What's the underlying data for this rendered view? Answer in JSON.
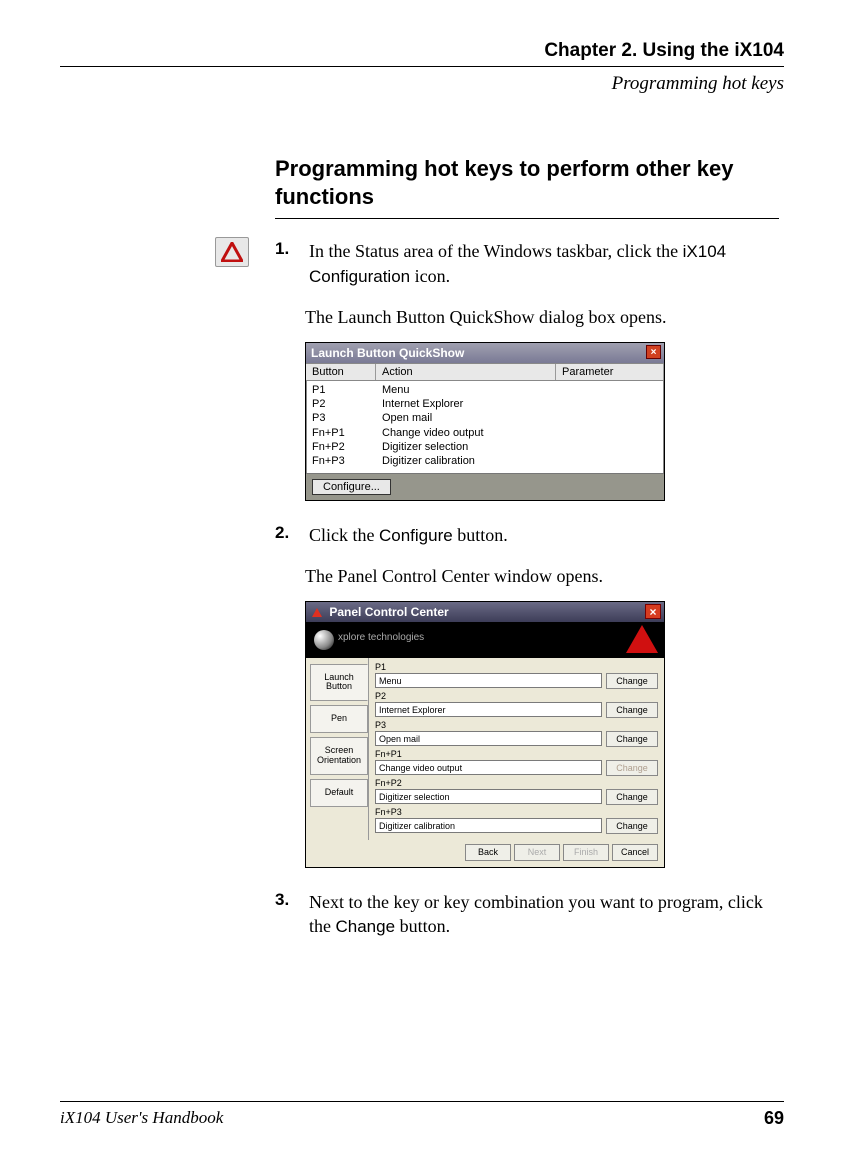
{
  "header": {
    "chapter": "Chapter 2. Using the iX104",
    "section": "Programming hot keys"
  },
  "heading": "Programming hot keys to perform other key functions",
  "steps": {
    "s1": {
      "num": "1.",
      "text_a": "In the Status area of the Windows taskbar, click the ",
      "ui_a": "iX104 Configuration",
      "text_b": " icon.",
      "follow": "The Launch Button QuickShow dialog box opens."
    },
    "s2": {
      "num": "2.",
      "text_a": "Click the ",
      "ui_a": "Configure",
      "text_b": " button.",
      "follow": "The Panel Control Center window opens."
    },
    "s3": {
      "num": "3.",
      "text_a": "Next to the key or key combination you want to program, click the ",
      "ui_a": "Change",
      "text_b": " button."
    }
  },
  "quickshow": {
    "title": "Launch Button QuickShow",
    "close_glyph": "×",
    "headers": {
      "button": "Button",
      "action": "Action",
      "parameter": "Parameter"
    },
    "rows": [
      {
        "b": "P1",
        "a": "Menu"
      },
      {
        "b": "P2",
        "a": "Internet Explorer"
      },
      {
        "b": "P3",
        "a": "Open mail"
      },
      {
        "b": "Fn+P1",
        "a": "Change video output"
      },
      {
        "b": "Fn+P2",
        "a": "Digitizer selection"
      },
      {
        "b": "Fn+P3",
        "a": "Digitizer calibration"
      }
    ],
    "configure": "Configure..."
  },
  "pcc": {
    "title": "Panel Control Center",
    "close_glyph": "×",
    "banner_text": "xplore technologies",
    "tabs": {
      "launch": "Launch\nButton",
      "pen": "Pen",
      "screen": "Screen\nOrientation",
      "default": "Default"
    },
    "rows": [
      {
        "label": "P1",
        "value": "Menu",
        "btn": "Change",
        "disabled": false
      },
      {
        "label": "P2",
        "value": "Internet Explorer",
        "btn": "Change",
        "disabled": false
      },
      {
        "label": "P3",
        "value": "Open mail",
        "btn": "Change",
        "disabled": false
      },
      {
        "label": "Fn+P1",
        "value": "Change video output",
        "btn": "Change",
        "disabled": true
      },
      {
        "label": "Fn+P2",
        "value": "Digitizer selection",
        "btn": "Change",
        "disabled": false
      },
      {
        "label": "Fn+P3",
        "value": "Digitizer calibration",
        "btn": "Change",
        "disabled": false
      }
    ],
    "footer": {
      "back": "Back",
      "next": "Next",
      "finish": "Finish",
      "cancel": "Cancel"
    }
  },
  "footer": {
    "left": "iX104 User's Handbook",
    "right": "69"
  }
}
